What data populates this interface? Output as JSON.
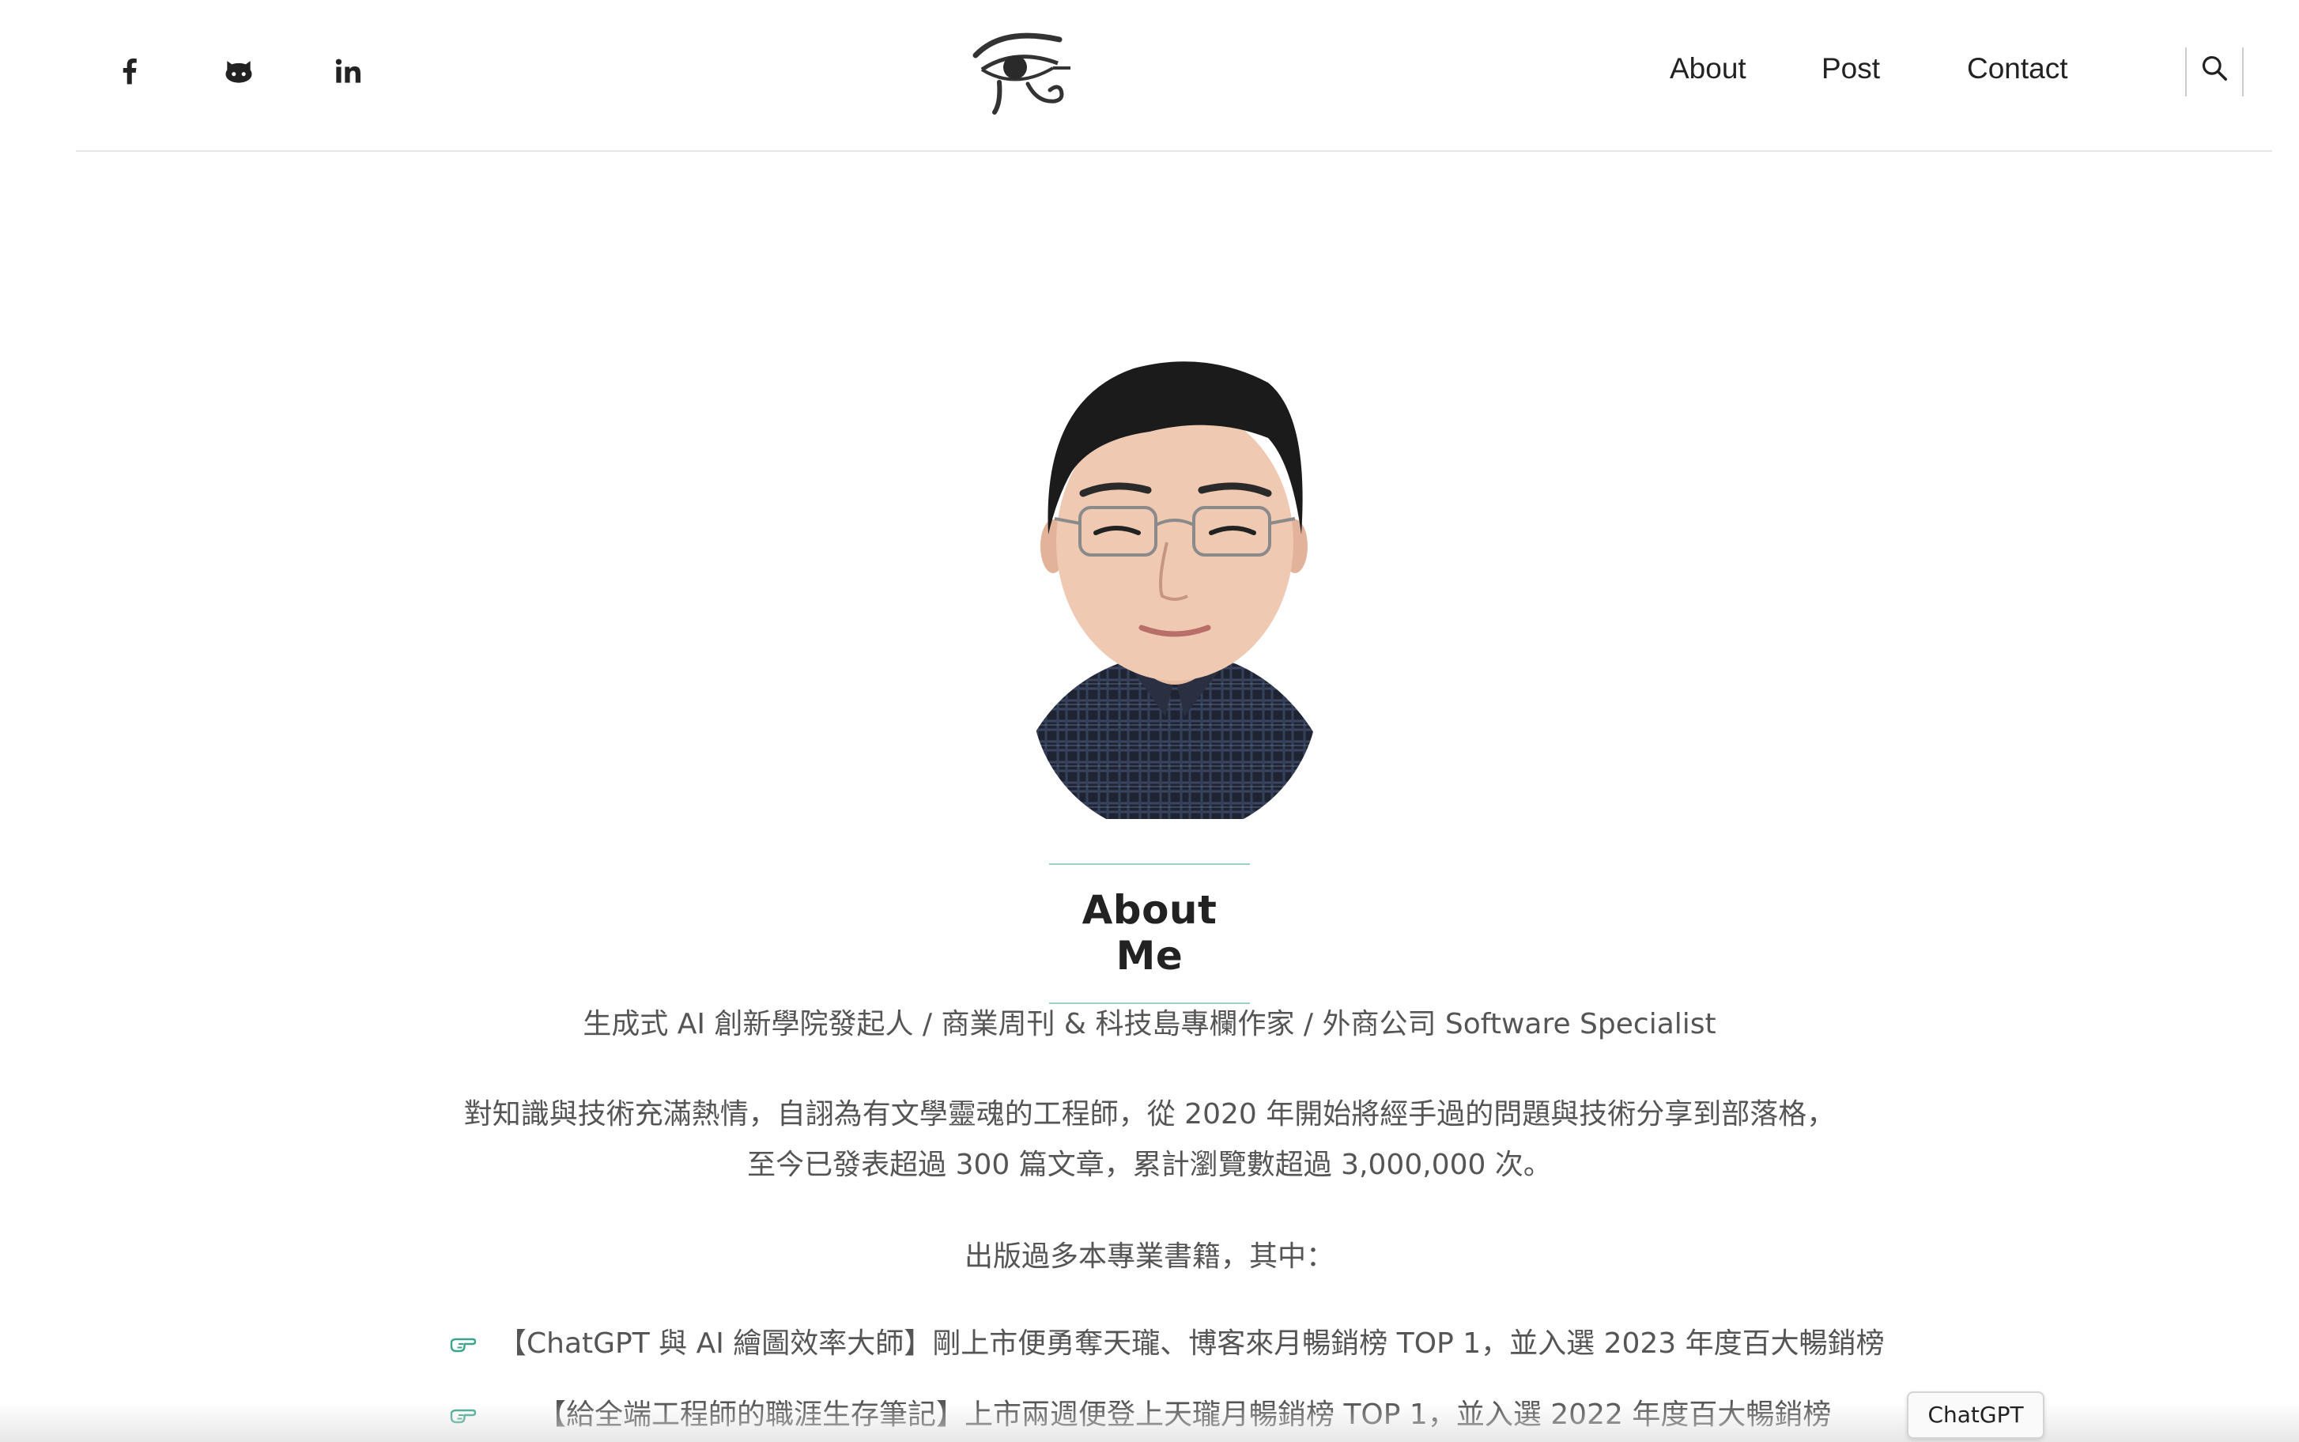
{
  "nav": {
    "about": "About",
    "post": "Post",
    "contact": "Contact"
  },
  "social_icons": [
    "facebook-icon",
    "github-icon",
    "linkedin-icon"
  ],
  "logo_icon": "eye-of-horus-logo",
  "hero": {
    "title": "About Me",
    "subtitle": "生成式 AI 創新學院發起人 / 商業周刊 & 科技島專欄作家 / 外商公司 Software Specialist",
    "intro_line1": "對知識與技術充滿熱情，自詡為有文學靈魂的工程師，從 2020 年開始將經手過的問題與技術分享到部落格，",
    "intro_line2": "至今已發表超過 300 篇文章，累計瀏覽數超過 3,000,000 次。",
    "books_intro": "出版過多本專業書籍，其中："
  },
  "books": [
    "【ChatGPT 與 AI 繪圖效率大師】剛上市便勇奪天瓏、博客來月暢銷榜 TOP 1，並入選 2023 年度百大暢銷榜",
    "【給全端工程師的職涯生存筆記】上市兩週便登上天瓏月暢銷榜 TOP 1，並入選 2022 年度百大暢銷榜"
  ],
  "floating_chip": "ChatGPT",
  "colors": {
    "accent": "#9dd3c6",
    "hand_icon": "#3aa58c",
    "text": "#555555",
    "heading": "#222222"
  }
}
